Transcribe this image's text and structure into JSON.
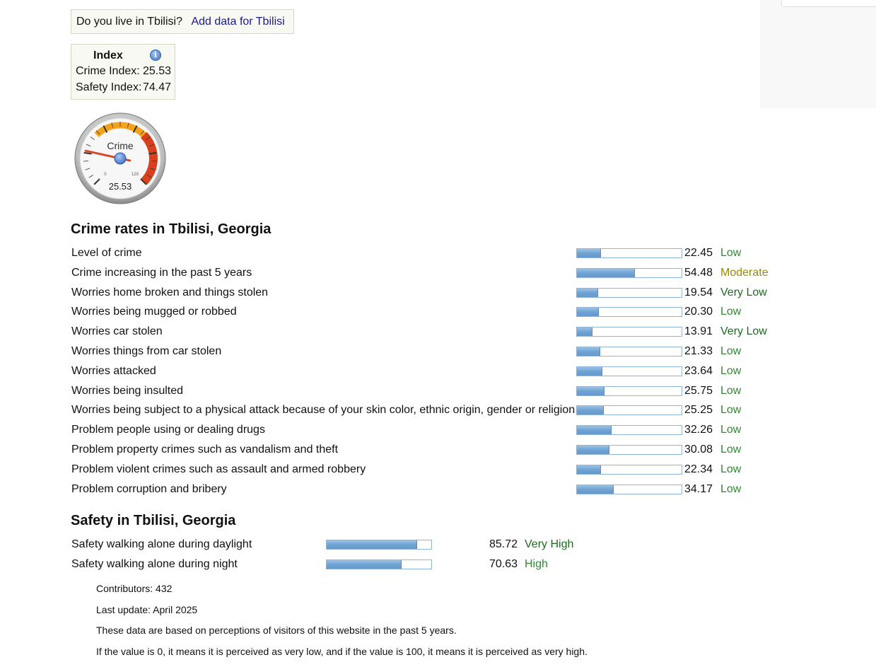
{
  "live_prompt": {
    "question": "Do you live in Tbilisi?",
    "link": "Add data for Tbilisi"
  },
  "index": {
    "title": "Index",
    "crime_label": "Crime Index:",
    "crime_value": "25.53",
    "safety_label": "Safety Index:",
    "safety_value": "74.47"
  },
  "gauge": {
    "label": "Crime",
    "value": "25.53",
    "value_num": 25.53,
    "min_label": "0",
    "max_label": "120",
    "min": 0,
    "max": 120
  },
  "crime_section": {
    "title": "Crime rates in Tbilisi, Georgia",
    "rows": [
      {
        "label": "Level of crime",
        "value": "22.45",
        "level": "Low",
        "level_class": "lvl-low",
        "pct": 22.45
      },
      {
        "label": "Crime increasing in the past 5 years",
        "value": "54.48",
        "level": "Moderate",
        "level_class": "lvl-mod",
        "pct": 54.48
      },
      {
        "label": "Worries home broken and things stolen",
        "value": "19.54",
        "level": "Very Low",
        "level_class": "lvl-verylow",
        "pct": 19.54
      },
      {
        "label": "Worries being mugged or robbed",
        "value": "20.30",
        "level": "Low",
        "level_class": "lvl-low",
        "pct": 20.3
      },
      {
        "label": "Worries car stolen",
        "value": "13.91",
        "level": "Very Low",
        "level_class": "lvl-verylow",
        "pct": 13.91
      },
      {
        "label": "Worries things from car stolen",
        "value": "21.33",
        "level": "Low",
        "level_class": "lvl-low",
        "pct": 21.33
      },
      {
        "label": "Worries attacked",
        "value": "23.64",
        "level": "Low",
        "level_class": "lvl-low",
        "pct": 23.64
      },
      {
        "label": "Worries being insulted",
        "value": "25.75",
        "level": "Low",
        "level_class": "lvl-low",
        "pct": 25.75
      },
      {
        "label": "Worries being subject to a physical attack because of your skin color, ethnic origin, gender or religion",
        "value": "25.25",
        "level": "Low",
        "level_class": "lvl-low",
        "pct": 25.25
      },
      {
        "label": "Problem people using or dealing drugs",
        "value": "32.26",
        "level": "Low",
        "level_class": "lvl-low",
        "pct": 32.26
      },
      {
        "label": "Problem property crimes such as vandalism and theft",
        "value": "30.08",
        "level": "Low",
        "level_class": "lvl-low",
        "pct": 30.08
      },
      {
        "label": "Problem violent crimes such as assault and armed robbery",
        "value": "22.34",
        "level": "Low",
        "level_class": "lvl-low",
        "pct": 22.34
      },
      {
        "label": "Problem corruption and bribery",
        "value": "34.17",
        "level": "Low",
        "level_class": "lvl-low",
        "pct": 34.17
      }
    ]
  },
  "safety_section": {
    "title": "Safety in Tbilisi, Georgia",
    "rows": [
      {
        "label": "Safety walking alone during daylight",
        "value": "85.72",
        "level": "Very High",
        "level_class": "lvl-verylow",
        "pct": 85.72
      },
      {
        "label": "Safety walking alone during night",
        "value": "70.63",
        "level": "High",
        "level_class": "lvl-high",
        "pct": 70.63
      }
    ]
  },
  "notes": {
    "contributors": "Contributors: 432",
    "last_update": "Last update: April 2025",
    "perception": "These data are based on perceptions of visitors of this website in the past 5 years.",
    "scale": "If the value is 0, it means it is perceived as very low, and if the value is 100, it means it is perceived as very high."
  }
}
